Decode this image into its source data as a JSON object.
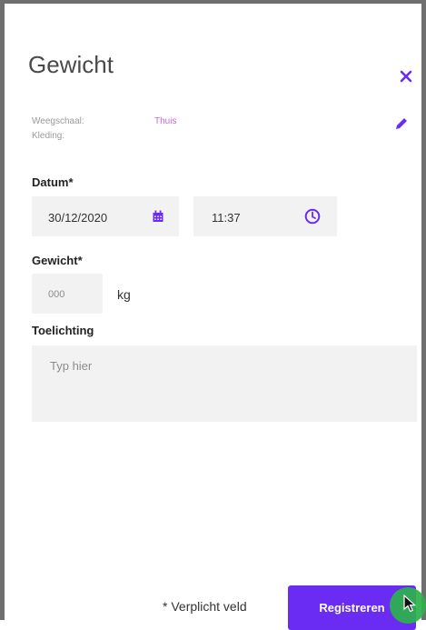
{
  "dialog": {
    "title": "Gewicht",
    "meta": {
      "scale_label": "Weegschaal:",
      "scale_value": "Thuis",
      "clothing_label": "Kleding:"
    },
    "date_section": {
      "label": "Datum*",
      "date_value": "30/12/2020",
      "time_value": "11:37"
    },
    "weight_section": {
      "label": "Gewicht*",
      "placeholder": "000",
      "unit": "kg"
    },
    "note_section": {
      "label": "Toelichting",
      "placeholder": "Typ hier"
    },
    "footer": {
      "required_note": "* Verplicht veld",
      "submit_label": "Registreren"
    }
  },
  "colors": {
    "accent": "#6a2cf2",
    "meta_value": "#c86bd8",
    "field_bg": "#f2f2f2",
    "cursor_halo": "#2bb24c"
  },
  "icons": {
    "close": "close-icon",
    "edit": "pencil-icon",
    "calendar": "calendar-icon",
    "clock": "clock-icon",
    "cursor": "mouse-cursor-icon"
  }
}
